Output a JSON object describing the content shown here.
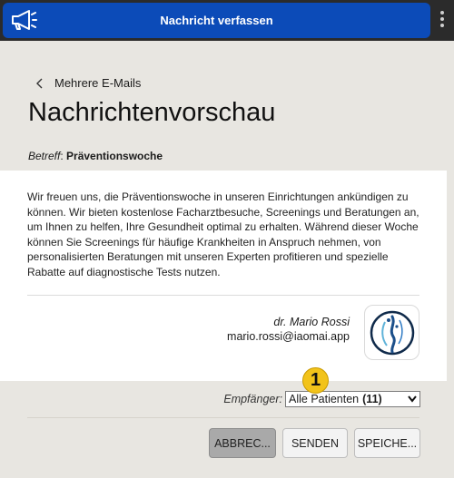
{
  "header": {
    "title": "Nachricht verfassen",
    "icon": "megaphone-icon",
    "menu_icon": "kebab-menu-icon",
    "accent": "#0c4bb8"
  },
  "nav": {
    "back_label": "Mehrere E-Mails"
  },
  "page": {
    "title": "Nachrichtenvorschau"
  },
  "subject": {
    "label": "Betreff",
    "value": "Präventionswoche"
  },
  "message": {
    "body": "Wir freuen uns, die Präventionswoche in unseren Einrichtungen ankündigen zu können. Wir bieten kostenlose Facharztbesuche, Screenings und Beratungen an, um Ihnen zu helfen, Ihre Gesundheit optimal zu erhalten. Während dieser Woche können Sie Screenings für häufige Krankheiten in Anspruch nehmen, von personalisierten Beratungen mit unseren Experten profitieren und spezielle Rabatte auf diagnostische Tests nutzen.",
    "signature_name": "dr. Mario Rossi",
    "signature_email": "mario.rossi@iaomai.app"
  },
  "recipients": {
    "label": "Empfänger",
    "selected": "Alle Patienten",
    "count": "(11)"
  },
  "badge": {
    "number": "1",
    "color": "#f2c31a"
  },
  "buttons": {
    "cancel": "ABBREC...",
    "send": "SENDEN",
    "save": "SPEICHE..."
  }
}
